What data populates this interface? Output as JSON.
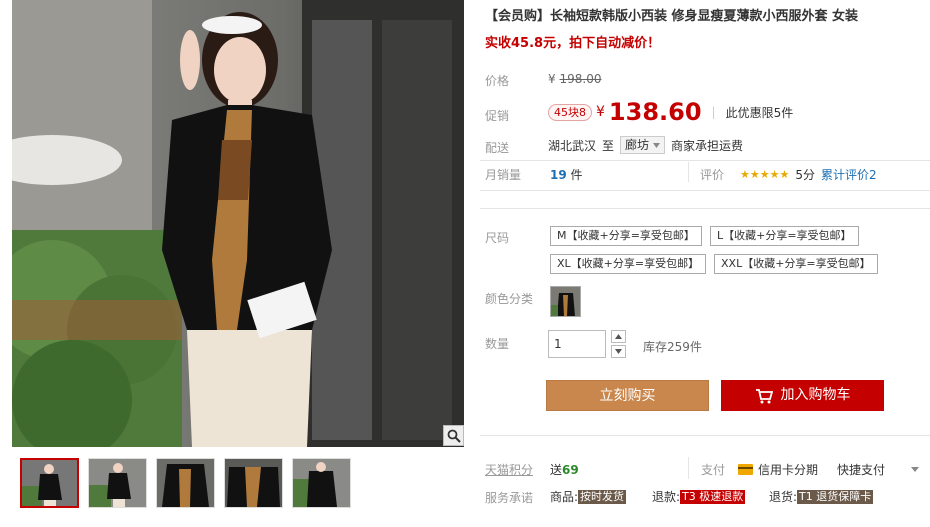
{
  "product": {
    "title": "【会员购】长袖短款韩版小西装 修身显瘦夏薄款小西服外套 女装",
    "promo": "实收45.8元，拍下自动减价！"
  },
  "price": {
    "label": "价格",
    "currency": "¥",
    "original": "198.00"
  },
  "promotion": {
    "label": "促销",
    "badge": "45块8",
    "currency": "¥",
    "price": "138.60",
    "limit": "此优惠限5件"
  },
  "shipping": {
    "label": "配送",
    "from": "湖北武汉",
    "to_word": "至",
    "destination": "廊坊",
    "note": "商家承担运费"
  },
  "sales": {
    "label": "月销量",
    "count": "19",
    "unit": "件",
    "rating_label": "评价",
    "stars": "★★★★★",
    "score": "5分",
    "reviews": "累计评价2"
  },
  "size": {
    "label": "尺码",
    "options": [
      "M【收藏+分享=享受包邮】",
      "L【收藏+分享=享受包邮】",
      "XL【收藏+分享=享受包邮】",
      "XXL【收藏+分享=享受包邮】"
    ]
  },
  "color": {
    "label": "颜色分类"
  },
  "quantity": {
    "label": "数量",
    "value": "1",
    "stock": "库存259件"
  },
  "actions": {
    "buy": "立刻购买",
    "cart": "加入购物车"
  },
  "points": {
    "label": "天猫积分",
    "text": "送",
    "value": "69"
  },
  "payment": {
    "label": "支付",
    "credit": "信用卡分期",
    "quick": "快捷支付"
  },
  "service": {
    "label": "服务承诺",
    "goods_label": "商品:",
    "goods_tag": "按时发货",
    "refund_label": "退款:",
    "refund_tag": "T3 极速退款",
    "return_label": "退货:",
    "return_tag": "T1 退货保障卡"
  },
  "colors": {
    "accent": "#c40000",
    "buy_button": "#c9874e"
  }
}
